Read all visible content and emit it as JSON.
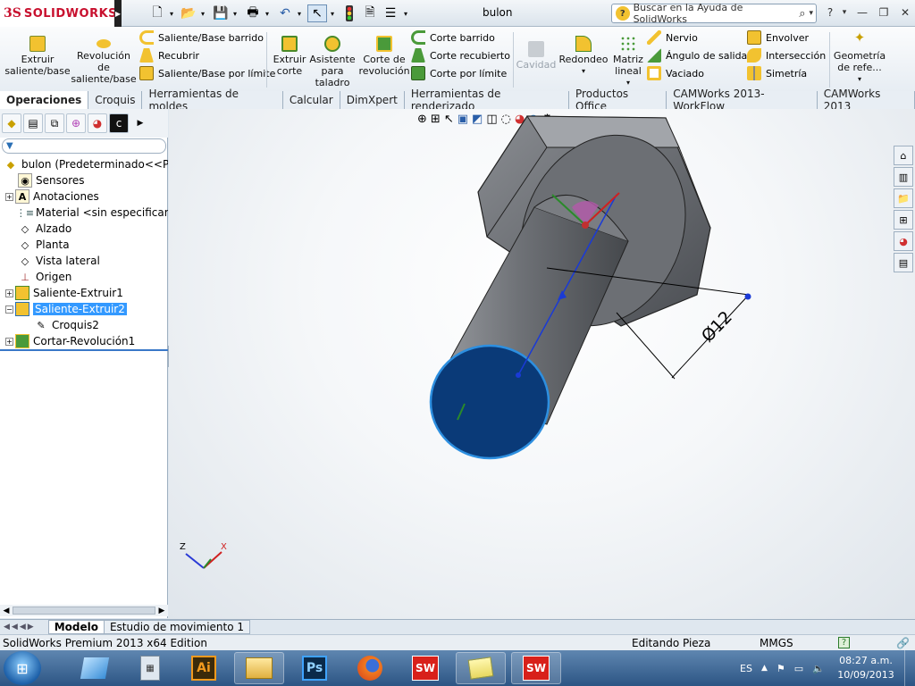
{
  "app": {
    "brand_ds": "3S",
    "brand_name": "SOLIDWORKS",
    "doc_title": "bulon"
  },
  "search": {
    "placeholder": "Buscar en la Ayuda de SolidWorks"
  },
  "commands": {
    "extruir_saliente": "Extruir saliente/base",
    "revolucion_saliente": "Revolución de saliente/base",
    "saliente_barrido": "Saliente/Base barrido",
    "recubrir": "Recubrir",
    "saliente_limite": "Saliente/Base por límite",
    "extruir_corte": "Extruir corte",
    "asistente_taladro": "Asistente para taladro",
    "corte_revolucion": "Corte de revolución",
    "corte_barrido": "Corte barrido",
    "corte_recubierto": "Corte recubierto",
    "corte_limite": "Corte por límite",
    "cavidad": "Cavidad",
    "redondeo": "Redondeo",
    "matriz_lineal": "Matriz lineal",
    "nervio": "Nervio",
    "angulo_salida": "Ángulo de salida",
    "vaciado": "Vaciado",
    "envolver": "Envolver",
    "interseccion": "Intersección",
    "simetria": "Simetría",
    "geometria_ref": "Geometría de refe..."
  },
  "tabs": [
    "Operaciones",
    "Croquis",
    "Herramientas de moldes",
    "Calcular",
    "DimXpert",
    "Herramientas de renderizado",
    "Productos Office",
    "CAMWorks 2013-WorkFlow",
    "CAMWorks 2013"
  ],
  "tree": {
    "root": "bulon  (Predeterminado<<Pred",
    "items": [
      "Sensores",
      "Anotaciones",
      "Material <sin especificar>",
      "Alzado",
      "Planta",
      "Vista lateral",
      "Origen",
      "Saliente-Extruir1",
      "Saliente-Extruir2",
      "Croquis2",
      "Cortar-Revolución1"
    ]
  },
  "model": {
    "dimension": "Ø12"
  },
  "triad": {
    "z": "Z",
    "x": "X"
  },
  "bottom_tabs": [
    "Modelo",
    "Estudio de movimiento 1"
  ],
  "status": {
    "edition": "SolidWorks Premium 2013 x64 Edition",
    "mode": "Editando Pieza",
    "units": "MMGS"
  },
  "taskbar": {
    "lang": "ES",
    "time": "08:27 a.m.",
    "date": "10/09/2013",
    "ai": "Ai",
    "ps": "Ps",
    "sw": "SW"
  },
  "colors": {
    "accent": "#3399ff",
    "face_selected": "#0a3a78",
    "body": "#707378",
    "dimension": "#000000"
  }
}
